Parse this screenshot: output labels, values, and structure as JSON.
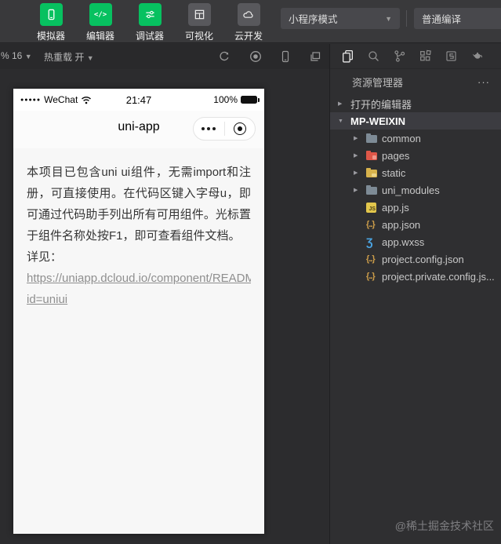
{
  "top_toolbar": {
    "buttons": [
      {
        "label": "模拟器",
        "icon": "simulator-phone-icon",
        "active": true
      },
      {
        "label": "编辑器",
        "icon": "code-icon",
        "active": true
      },
      {
        "label": "调试器",
        "icon": "sliders-icon",
        "active": true
      },
      {
        "label": "可视化",
        "icon": "layout-icon",
        "active": false
      },
      {
        "label": "云开发",
        "icon": "cloud-icon",
        "active": false
      }
    ],
    "mode_dropdown": "小程序模式",
    "compile_dropdown": "普通编译"
  },
  "sim_toolbar": {
    "zoom_label": "% 16",
    "hot_reload_label": "热重载 开",
    "icons": [
      "refresh-icon",
      "record-stop-icon",
      "phone-icon",
      "windows-icon"
    ]
  },
  "explorer": {
    "activity_icons": [
      "files-icon",
      "search-icon",
      "source-control-icon",
      "extensions-icon",
      "snippets-icon",
      "teapot-icon"
    ],
    "header": "资源管理器",
    "more": "···",
    "tree": [
      {
        "label": "打开的编辑器"
      },
      {
        "label": "MP-WEIXIN"
      },
      {
        "label": "common"
      },
      {
        "label": "pages"
      },
      {
        "label": "static"
      },
      {
        "label": "uni_modules"
      },
      {
        "label": "app.js"
      },
      {
        "label": "app.json"
      },
      {
        "label": "app.wxss"
      },
      {
        "label": "project.config.json"
      },
      {
        "label": "project.private.config.js..."
      }
    ]
  },
  "phone": {
    "status": {
      "signal_dots": "●●●●●",
      "carrier": "WeChat",
      "time": "21:47",
      "battery": "100%"
    },
    "nav": {
      "title": "uni-app"
    },
    "content": {
      "paragraph": "本项目已包含uni ui组件，无需import和注册，可直接使用。在代码区键入字母u，即可通过代码助手列出所有可用组件。光标置于组件名称处按F1，即可查看组件文档。",
      "see_label": "详见：",
      "link_line1": "https://uniapp.dcloud.io/component/READM",
      "link_line2": "id=uniui"
    }
  },
  "watermark": "@稀土掘金技术社区"
}
